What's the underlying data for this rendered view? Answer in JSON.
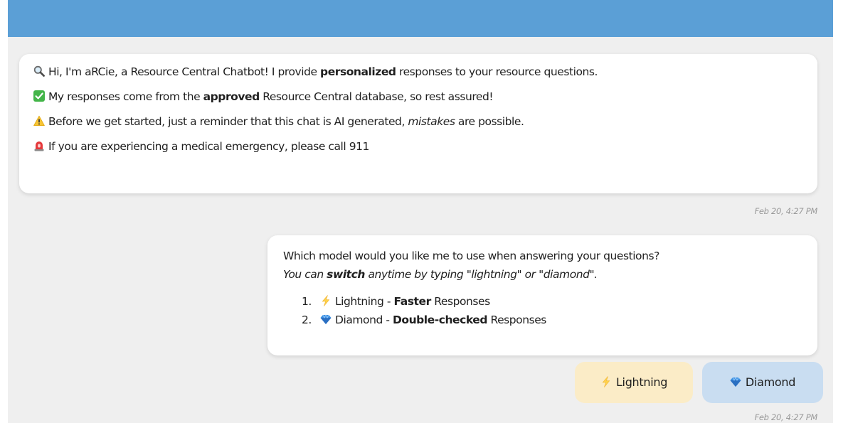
{
  "colors": {
    "header": "#5b9fd6",
    "frame_bg": "#efefef",
    "bubble_bg": "#ffffff",
    "lightning_chip": "#fbecc7",
    "diamond_chip": "#c9ddf1",
    "timestamp": "#9a9a9a"
  },
  "welcome": {
    "line1": {
      "icon": "magnifier-icon",
      "pre": "Hi, I'm aRCie, a Resource Central Chatbot! I provide ",
      "bold": "personalized",
      "post": " responses to your resource questions."
    },
    "line2": {
      "icon": "check-mark-icon",
      "pre": "My responses come from the ",
      "bold": "approved",
      "post": " Resource Central database, so rest assured!"
    },
    "line3": {
      "icon": "warning-icon",
      "pre": "Before we get started, just a reminder that this chat is AI generated, ",
      "italic": "mistakes",
      "post": " are possible."
    },
    "line4": {
      "icon": "siren-icon",
      "text": "If you are experiencing a medical emergency, please call 911"
    },
    "timestamp": "Feb 20, 4:27 PM"
  },
  "model_prompt": {
    "question": "Which model would you like me to use when answering your questions?",
    "hint_pre": "You can ",
    "hint_bold": "switch",
    "hint_post": " anytime by typing \"lightning\" or \"diamond\".",
    "options": [
      {
        "number": "1.",
        "icon": "lightning-icon",
        "name": "Lightning",
        "sep": " - ",
        "bold": "Faster",
        "post": " Responses"
      },
      {
        "number": "2.",
        "icon": "diamond-icon",
        "name": "Diamond",
        "sep": " - ",
        "bold": "Double-checked",
        "post": " Responses"
      }
    ],
    "timestamp": "Feb 20, 4:27 PM"
  },
  "quick_replies": {
    "lightning": "Lightning",
    "diamond": "Diamond"
  }
}
